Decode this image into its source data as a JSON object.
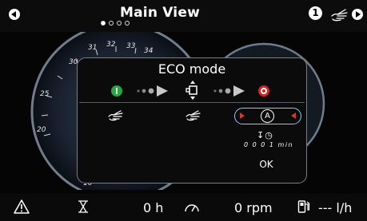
{
  "header": {
    "title": "Main View",
    "page_count": 4,
    "active_page": 1,
    "info_badge": "1",
    "icons": [
      "left-arrow-icon",
      "hand-icon",
      "right-arrow-icon"
    ]
  },
  "background_gauge": {
    "scale_labels": [
      "20",
      "25",
      "30",
      "31",
      "32",
      "33",
      "34",
      "10"
    ]
  },
  "dialog": {
    "title": "ECO mode",
    "auto_symbol": "A",
    "timer_value": "0 0 0 1 min",
    "ok_label": "OK",
    "colors": {
      "active": "#27a83d",
      "stop": "#d92128",
      "selected_border": "#8ec7ff",
      "arrow": "#e03030"
    }
  },
  "footer": {
    "hours": "0 h",
    "rpm": "0 rpm",
    "fuel": "--- l/h"
  }
}
